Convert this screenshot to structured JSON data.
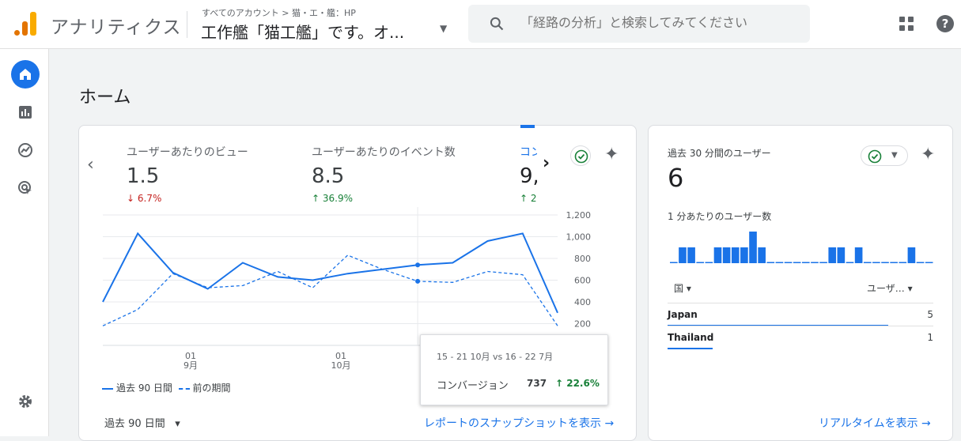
{
  "header": {
    "app_name": "アナリティクス",
    "breadcrumb": "すべてのアカウント > 猫・エ・艦：HP",
    "account_name": "工作艦「猫工艦」です。オ...",
    "search_placeholder": "「経路の分析」と検索してみてください"
  },
  "page": {
    "title": "ホーム"
  },
  "metrics": [
    {
      "label": "ユーザーあたりのビュー",
      "value": "1.5",
      "change": "6.7%",
      "direction": "down"
    },
    {
      "label": "ユーザーあたりのイベント数",
      "value": "8.5",
      "change": "36.9%",
      "direction": "up"
    },
    {
      "label": "コン",
      "value": "9,",
      "change": "2",
      "direction": "up"
    }
  ],
  "chart_data": {
    "type": "line",
    "x_tick_labels": [
      {
        "day": "01",
        "month": "9月"
      },
      {
        "day": "01",
        "month": "10月"
      }
    ],
    "y_ticks": [
      "1,200",
      "1,000",
      "800",
      "600",
      "400",
      "200"
    ],
    "ylim": [
      0,
      1200
    ],
    "series": [
      {
        "name": "過去 90 日間",
        "style": "solid",
        "values": [
          400,
          1030,
          670,
          520,
          760,
          630,
          600,
          660,
          700,
          740,
          760,
          960,
          1030,
          300
        ]
      },
      {
        "name": "前の期間",
        "style": "dashed",
        "values": [
          180,
          330,
          660,
          530,
          550,
          680,
          530,
          830,
          700,
          590,
          580,
          680,
          650,
          180
        ]
      }
    ],
    "highlight_index": 9
  },
  "legend": {
    "current": "過去 90 日間",
    "previous": "前の期間"
  },
  "tooltip": {
    "date": "15 - 21 10月 vs 16 - 22 7月",
    "label": "コンバージョン",
    "value": "737",
    "change": "22.6%"
  },
  "footer": {
    "period": "過去 90 日間",
    "snapshot_link": "レポートのスナップショットを表示"
  },
  "realtime": {
    "label": "過去 30 分間のユーザー",
    "value": "6",
    "sub_label": "1 分あたりのユーザー数",
    "minute_bars": [
      0,
      1,
      1,
      0,
      0,
      1,
      1,
      1,
      1,
      2,
      1,
      0,
      0,
      0,
      0,
      0,
      0,
      0,
      1,
      1,
      0,
      1,
      0,
      0,
      0,
      0,
      0,
      1,
      0,
      0
    ],
    "col_country": "国",
    "col_users": "ユーザ…",
    "rows": [
      {
        "country": "Japan",
        "users": "5",
        "share": 0.83
      },
      {
        "country": "Thailand",
        "users": "1",
        "share": 0.17
      }
    ],
    "link": "リアルタイムを表示"
  },
  "colors": {
    "accent": "#1a73e8",
    "up": "#188038",
    "down": "#c5221f"
  }
}
